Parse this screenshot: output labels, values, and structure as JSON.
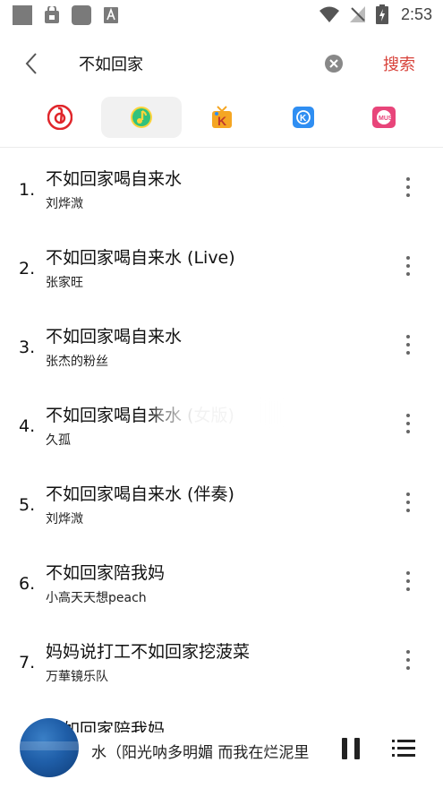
{
  "status_bar": {
    "time": "2:53",
    "icons": [
      "notification-square-icon",
      "lock-bag-icon",
      "app-square-icon",
      "font-a-icon",
      "wifi-icon",
      "no-signal-icon",
      "battery-charging-icon"
    ]
  },
  "search": {
    "query": "不如回家",
    "search_button": "搜索"
  },
  "sources": [
    {
      "name": "netease-music-icon",
      "active": false
    },
    {
      "name": "qq-music-icon",
      "active": true
    },
    {
      "name": "kuwo-music-icon",
      "active": false
    },
    {
      "name": "kugou-music-icon",
      "active": false
    },
    {
      "name": "migu-music-icon",
      "active": false
    }
  ],
  "results": [
    {
      "num": "1.",
      "title": "不如回家喝自来水",
      "artist": "刘烨溦"
    },
    {
      "num": "2.",
      "title": "不如回家喝自来水 (Live)",
      "artist": "张家旺"
    },
    {
      "num": "3.",
      "title": "不如回家喝自来水",
      "artist": "张杰的粉丝"
    },
    {
      "num": "4.",
      "title": "不如回家喝自来水 (女版)",
      "artist": "久孤"
    },
    {
      "num": "5.",
      "title": "不如回家喝自来水 (伴奏)",
      "artist": "刘烨溦"
    },
    {
      "num": "6.",
      "title": "不如回家陪我妈",
      "artist": "小高天天想peach"
    },
    {
      "num": "7.",
      "title": "妈妈说打工不如回家挖菠菜",
      "artist": "万華镜乐队"
    }
  ],
  "partial_row_title": "不如回家陪我妈",
  "player": {
    "now_playing": "水（阳光呐多明媚 而我在烂泥里"
  },
  "colors": {
    "accent": "#d8433b",
    "netease": "#e0262b",
    "qq": "#31c27c",
    "kuwo": "#f5a623",
    "kugou": "#2f8ef2",
    "migu": "#e8457a"
  }
}
